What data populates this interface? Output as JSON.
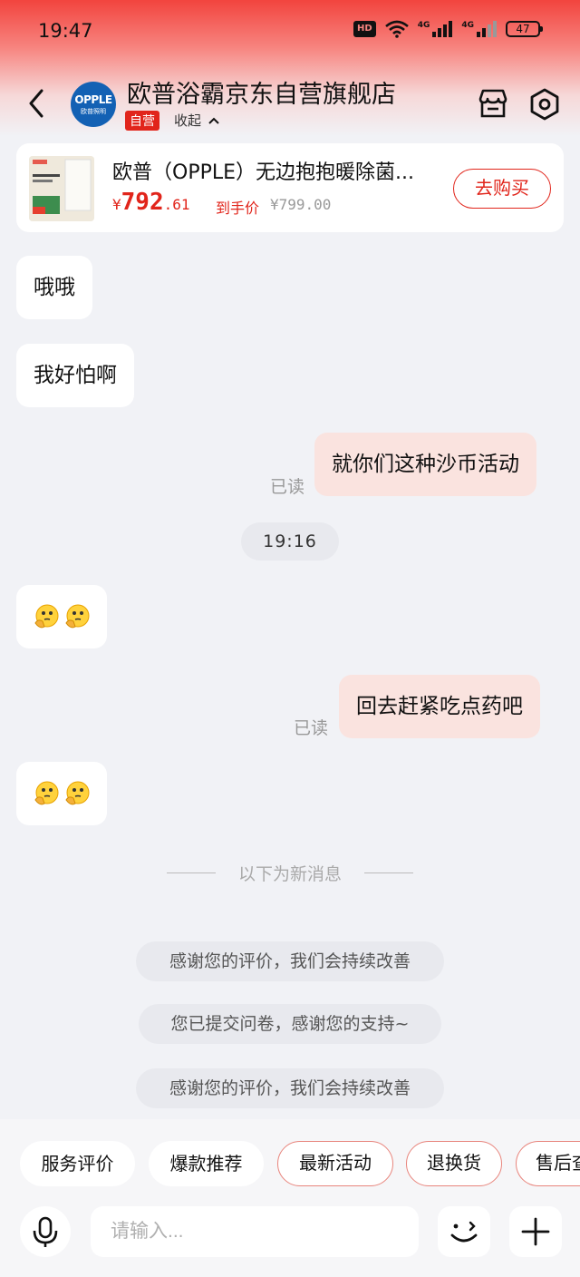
{
  "status_bar": {
    "time": "19:47",
    "hd_label": "HD",
    "net1": "4G",
    "net2": "4G",
    "battery": "47"
  },
  "header": {
    "shop_name": "欧普浴霸京东自营旗舰店",
    "self_run_badge": "自营",
    "collapse_label": "收起",
    "logo_text_en": "OPPLE",
    "logo_text_cn": "欧普照明",
    "icons": [
      "back-arrow-icon",
      "store-icon",
      "settings-icon"
    ]
  },
  "product": {
    "title": "欧普（OPPLE）无边抱抱暖除菌...",
    "price_symbol": "¥",
    "price_int": "792",
    "price_dec": ".61",
    "hand_price_label": "到手价",
    "original_price": "¥799.00",
    "buy_label": "去购买"
  },
  "messages": [
    {
      "side": "left",
      "type": "text",
      "text": "哦哦"
    },
    {
      "side": "left",
      "type": "text",
      "text": "我好怕啊"
    },
    {
      "side": "right",
      "type": "text",
      "text": "就你们这种沙币活动",
      "status": "已读"
    },
    {
      "side": "center",
      "type": "time",
      "text": "19:16"
    },
    {
      "side": "left",
      "type": "emoji",
      "emoji": "thinking-face-emoji x2"
    },
    {
      "side": "right",
      "type": "text",
      "text": "回去赶紧吃点药吧",
      "status": "已读"
    },
    {
      "side": "left",
      "type": "emoji",
      "emoji": "thinking-face-emoji x2"
    }
  ],
  "new_message_divider": "以下为新消息",
  "system_messages": [
    "感谢您的评价，我们会持续改善",
    "您已提交问卷，感谢您的支持~",
    "感谢您的评价，我们会持续改善"
  ],
  "quick_chips": [
    {
      "label": "服务评价",
      "active": false
    },
    {
      "label": "爆款推荐",
      "active": false
    },
    {
      "label": "最新活动",
      "active": true
    },
    {
      "label": "退换货",
      "active": true
    },
    {
      "label": "售后查",
      "active": true
    }
  ],
  "input": {
    "placeholder": "请输入..."
  },
  "colors": {
    "accent_red": "#e1251b",
    "bubble_right": "#fae3df",
    "background": "#f1f2f6"
  }
}
